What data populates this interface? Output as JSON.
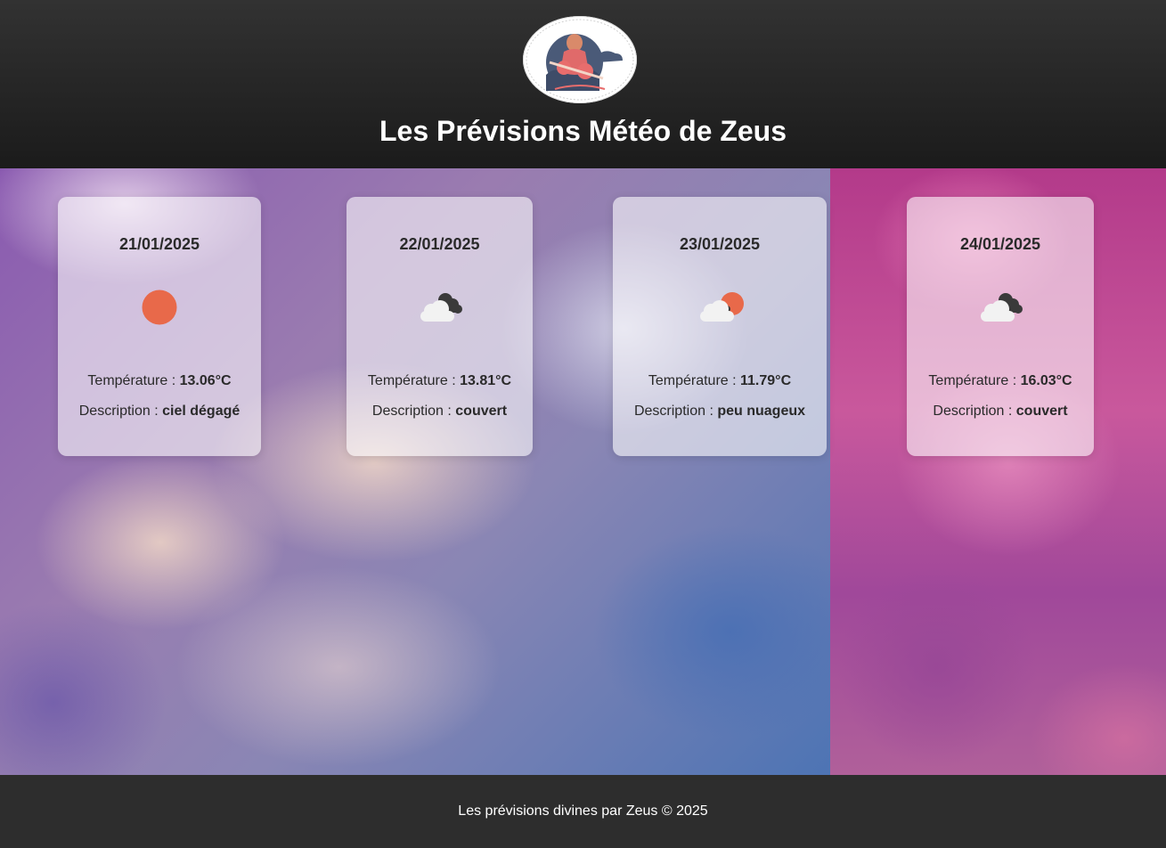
{
  "header": {
    "title": "Les Prévisions Météo de Zeus",
    "logo_icon": "zeus-logo-icon"
  },
  "forecast": [
    {
      "date": "21/01/2025",
      "icon": "sun-icon",
      "temp_label": "Température : ",
      "temp_value": "13.06°C",
      "desc_label": "Description : ",
      "desc_value": "ciel dégagé"
    },
    {
      "date": "22/01/2025",
      "icon": "overcast-clouds-icon",
      "temp_label": "Température : ",
      "temp_value": "13.81°C",
      "desc_label": "Description : ",
      "desc_value": "couvert"
    },
    {
      "date": "23/01/2025",
      "icon": "partly-cloudy-icon",
      "temp_label": "Température : ",
      "temp_value": "11.79°C",
      "desc_label": "Description : ",
      "desc_value": "peu nuageux"
    },
    {
      "date": "24/01/2025",
      "icon": "overcast-clouds-icon",
      "temp_label": "Température : ",
      "temp_value": "16.03°C",
      "desc_label": "Description : ",
      "desc_value": "couvert"
    }
  ],
  "footer": {
    "text": "Les prévisions divines par Zeus © 2025"
  },
  "colors": {
    "header_bg": "#2b2b2b",
    "footer_bg": "#2d2d2d",
    "sun": "#e8694a",
    "cloud_light": "#f2f2f2",
    "cloud_dark": "#3a3a3a"
  }
}
